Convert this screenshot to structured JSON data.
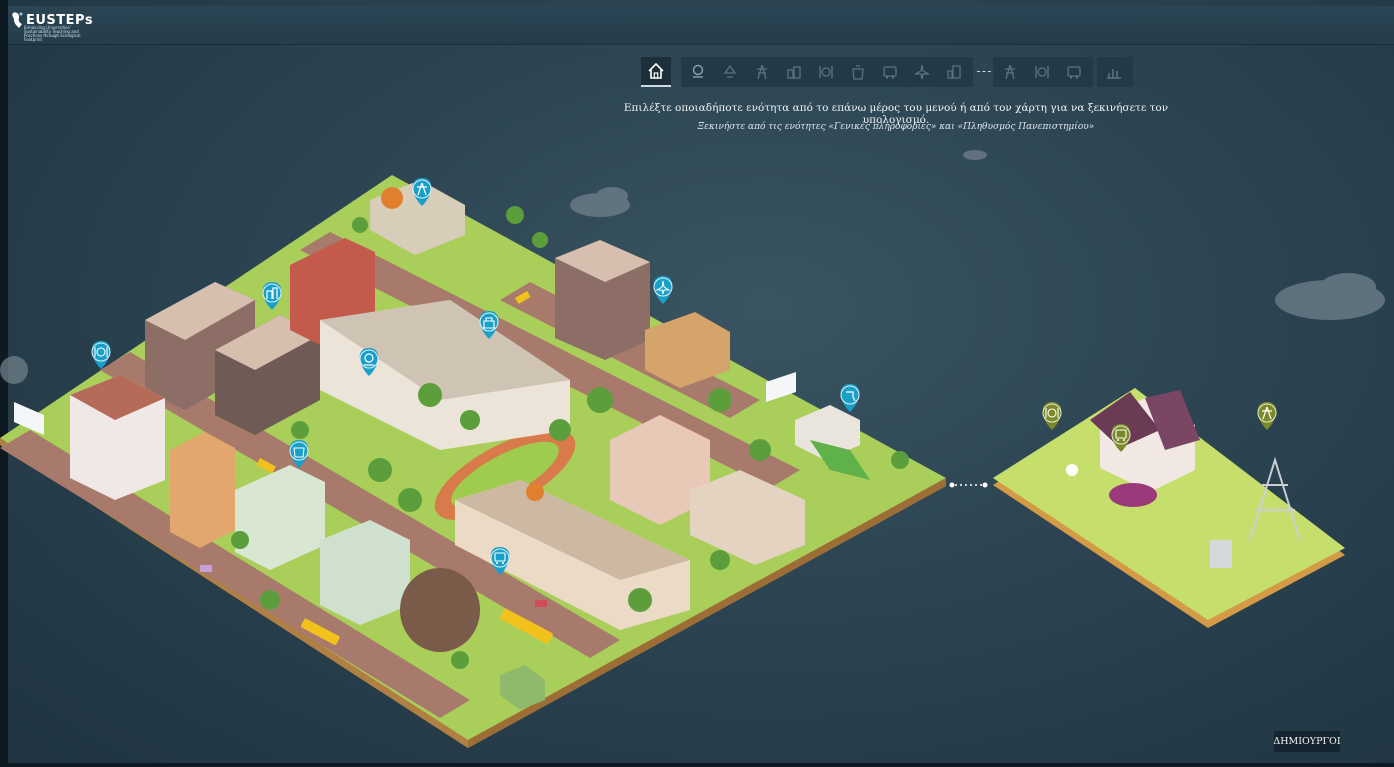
{
  "app": {
    "logo_text": "EUSTEPs",
    "logo_tagline": "Enhancing Universities' Sustainability Teaching and Practices through Ecological Footprint"
  },
  "menu": {
    "items": [
      {
        "id": "home",
        "icon": "home-icon"
      },
      {
        "id": "general-info",
        "icon": "location-pin-icon"
      },
      {
        "id": "water",
        "icon": "water-icon"
      },
      {
        "id": "electricity",
        "icon": "power-tower-icon"
      },
      {
        "id": "buildings",
        "icon": "building-icon"
      },
      {
        "id": "food",
        "icon": "plate-cutlery-icon"
      },
      {
        "id": "waste",
        "icon": "waste-icon"
      },
      {
        "id": "transport",
        "icon": "bus-icon"
      },
      {
        "id": "travel",
        "icon": "plane-icon"
      },
      {
        "id": "construction",
        "icon": "city-icon"
      },
      {
        "id": "household-energy",
        "icon": "power-tower-icon"
      },
      {
        "id": "household-food",
        "icon": "plate-cutlery-icon"
      },
      {
        "id": "household-transport",
        "icon": "bus-icon"
      },
      {
        "id": "results",
        "icon": "bar-chart-icon"
      }
    ]
  },
  "instructions": {
    "main": "Επιλέξτε οποιαδήποτε ενότητα από το επάνω μέρος του μενού ή από τον χάρτη για να ξεκινήσετε τον υπολογισμό.",
    "sub": "Ξεκινήστε από τις ενότητες «Γενικές πληροφορίες» και «Πληθυσμός Πανεπιστημίου»"
  },
  "footer": {
    "creators_label": "ΔΗΜΙΟΥΡΓΟΙ"
  },
  "colors": {
    "background": "#2c4452",
    "campus_pin": "#1aa0c8",
    "home_pin": "#7a8a2a",
    "grass": "#a9cf5a",
    "road": "#a77a6c"
  }
}
